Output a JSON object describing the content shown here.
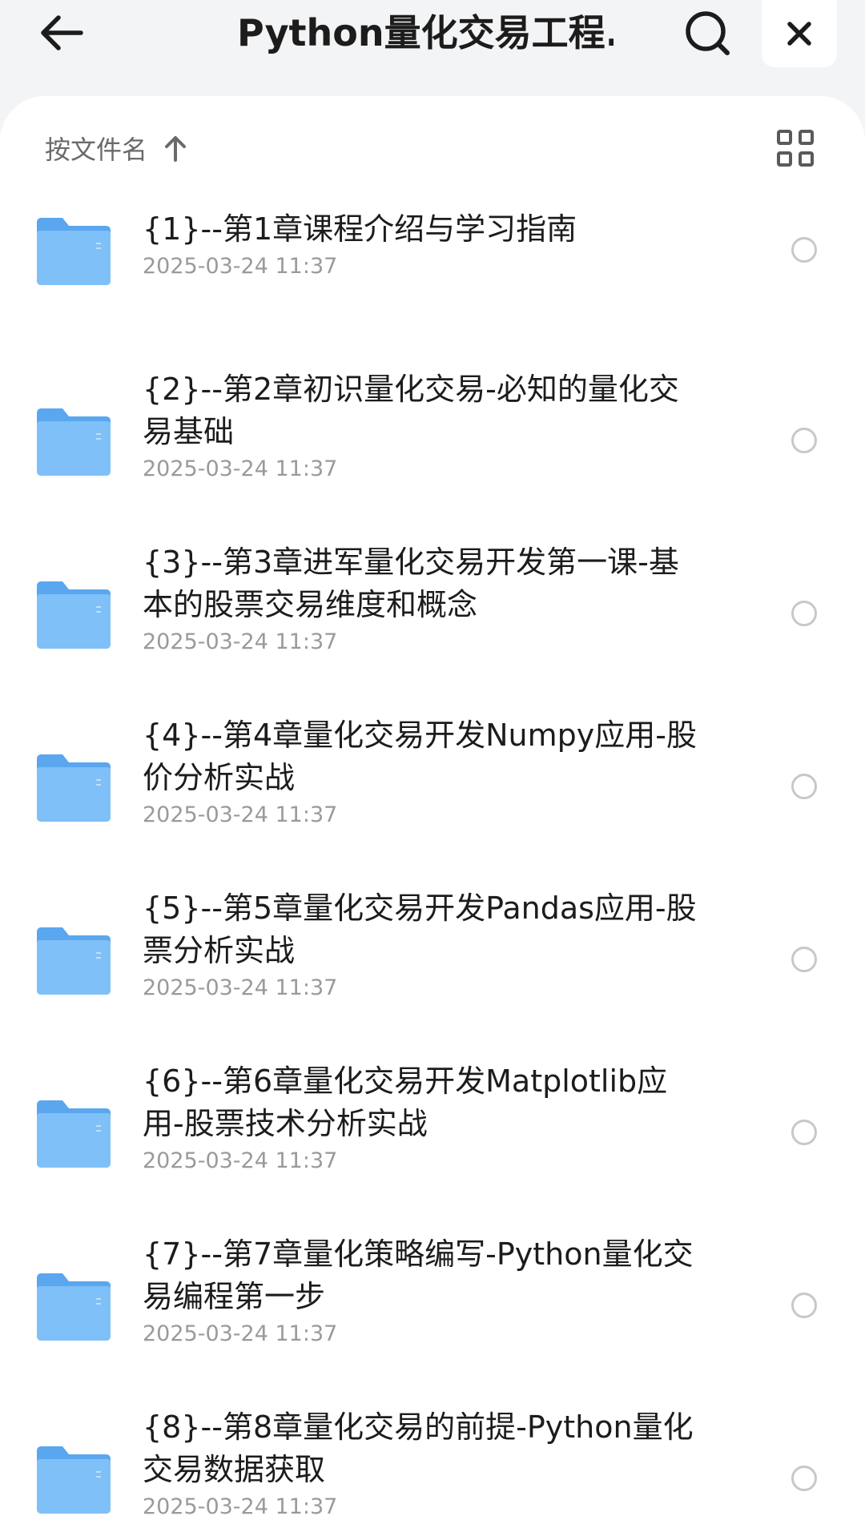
{
  "header": {
    "title": "Python量化交易工程...",
    "back_icon": "arrow-left-icon",
    "search_icon": "search-icon",
    "close_icon": "close-icon"
  },
  "toolbar": {
    "sort_label": "按文件名",
    "sort_icon": "arrow-up-icon",
    "view_icon": "grid-view-icon"
  },
  "colors": {
    "folder": "#6cb4f5",
    "background": "#f3f4f6",
    "sheet": "#ffffff"
  },
  "files": [
    {
      "name": "{1}--第1章课程介绍与学习指南",
      "date": "2025-03-24 11:37"
    },
    {
      "name": "{2}--第2章初识量化交易-必知的量化交易基础",
      "date": "2025-03-24 11:37"
    },
    {
      "name": "{3}--第3章进军量化交易开发第一课-基本的股票交易维度和概念",
      "date": "2025-03-24 11:37"
    },
    {
      "name": "{4}--第4章量化交易开发Numpy应用-股价分析实战",
      "date": "2025-03-24 11:37"
    },
    {
      "name": "{5}--第5章量化交易开发Pandas应用-股票分析实战",
      "date": "2025-03-24 11:37"
    },
    {
      "name": "{6}--第6章量化交易开发Matplotlib应用-股票技术分析实战",
      "date": "2025-03-24 11:37"
    },
    {
      "name": "{7}--第7章量化策略编写-Python量化交易编程第一步",
      "date": "2025-03-24 11:37"
    },
    {
      "name": "{8}--第8章量化交易的前提-Python量化交易数据获取",
      "date": "2025-03-24 11:37"
    }
  ]
}
